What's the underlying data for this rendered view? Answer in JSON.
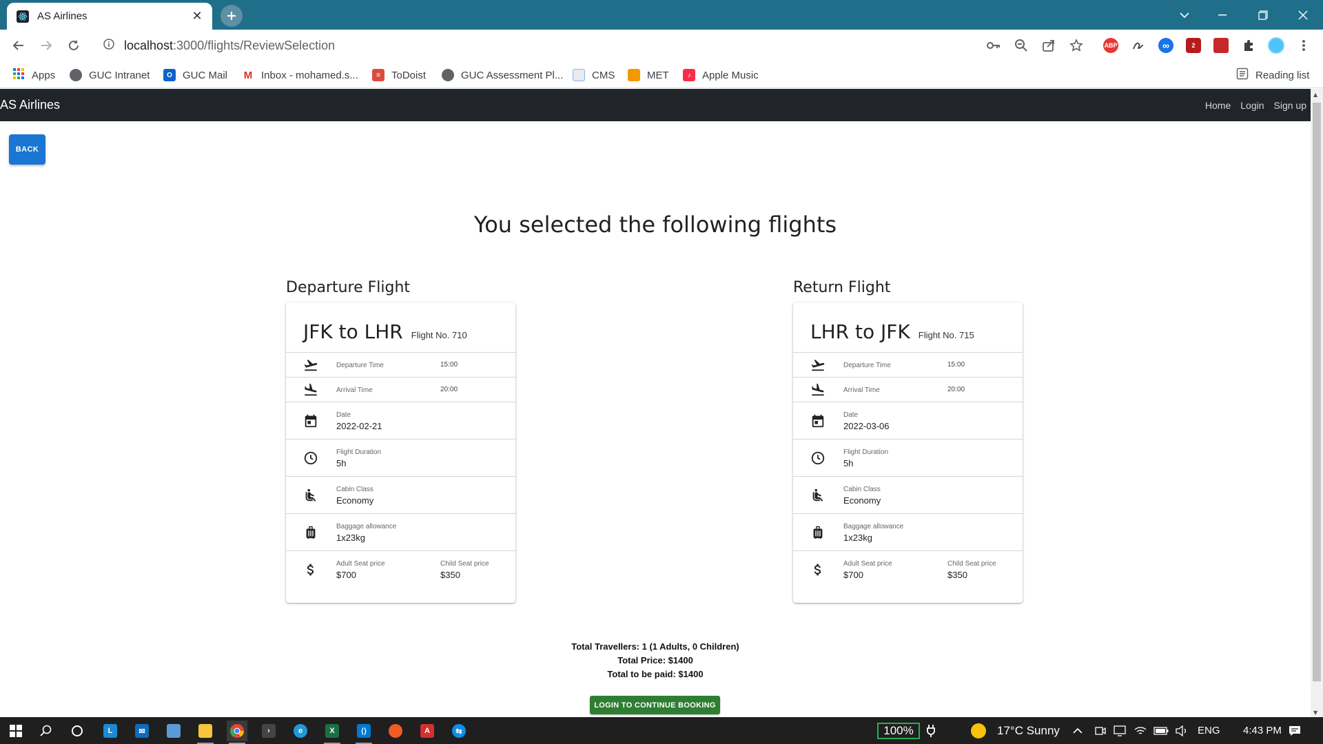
{
  "browser": {
    "tab_title": "AS Airlines",
    "url_host": "localhost",
    "url_path": ":3000/flights/ReviewSelection",
    "bookmarks": [
      {
        "label": "Apps",
        "icon": "apps-grid-icon",
        "color": "#1a73e8"
      },
      {
        "label": "GUC Intranet",
        "icon": "globe-icon",
        "color": "#5f6368"
      },
      {
        "label": "GUC Mail",
        "icon": "outlook-icon",
        "color": "#0a64c9"
      },
      {
        "label": "Inbox - mohamed.s...",
        "icon": "gmail-icon",
        "color": "#d93025"
      },
      {
        "label": "ToDoist",
        "icon": "todoist-icon",
        "color": "#db4c3f"
      },
      {
        "label": "GUC Assessment Pl...",
        "icon": "globe-icon",
        "color": "#5f6368"
      },
      {
        "label": "CMS",
        "icon": "document-icon",
        "color": "#8ab4f8"
      },
      {
        "label": "MET",
        "icon": "met-icon",
        "color": "#f29900"
      },
      {
        "label": "Apple Music",
        "icon": "apple-music-icon",
        "color": "#fa2d48"
      }
    ],
    "reading_list": "Reading list",
    "extensions": [
      {
        "label": "ABP",
        "color": "#e53935"
      },
      {
        "label": "",
        "color": "#3c4043"
      },
      {
        "label": "∞",
        "color": "#1a73e8"
      },
      {
        "label": "2",
        "color": "#b71c1c"
      },
      {
        "label": "",
        "color": "#c62828"
      }
    ]
  },
  "app": {
    "brand": "AS Airlines",
    "nav": [
      "Home",
      "Login",
      "Sign up"
    ],
    "back_label": "BACK",
    "heading": "You selected the following flights",
    "flights": [
      {
        "section": "Departure Flight",
        "route": "JFK to LHR",
        "flight_no": "Flight No. 710",
        "departure_time_label": "Departure Time",
        "departure_time": "15:00",
        "arrival_time_label": "Arrival Time",
        "arrival_time": "20:00",
        "date_label": "Date",
        "date": "2022-02-21",
        "duration_label": "Flight Duration",
        "duration": "5h",
        "cabin_label": "Cabin Class",
        "cabin": "Economy",
        "baggage_label": "Baggage allowance",
        "baggage": "1x23kg",
        "adult_price_label": "Adult Seat price",
        "adult_price": "$700",
        "child_price_label": "Child Seat price",
        "child_price": "$350"
      },
      {
        "section": "Return Flight",
        "route": "LHR to JFK",
        "flight_no": "Flight No. 715",
        "departure_time_label": "Departure Time",
        "departure_time": "15:00",
        "arrival_time_label": "Arrival Time",
        "arrival_time": "20:00",
        "date_label": "Date",
        "date": "2022-03-06",
        "duration_label": "Flight Duration",
        "duration": "5h",
        "cabin_label": "Cabin Class",
        "cabin": "Economy",
        "baggage_label": "Baggage allowance",
        "baggage": "1x23kg",
        "adult_price_label": "Adult Seat price",
        "adult_price": "$700",
        "child_price_label": "Child Seat price",
        "child_price": "$350"
      }
    ],
    "summary": {
      "travellers": "Total Travellers: 1 (1 Adults, 0 Children)",
      "total_price": "Total Price: $1400",
      "to_be_paid": "Total to be paid: $1400"
    },
    "cta_label": "LOGIN TO CONTINUE BOOKING",
    "colors": {
      "primary": "#1976d2",
      "success": "#2e7d32",
      "appbar": "#212529",
      "chrome": "#1f6f8b"
    }
  },
  "taskbar": {
    "battery": "100%",
    "weather": "17°C  Sunny",
    "language": "ENG",
    "time": "4:43 PM"
  }
}
